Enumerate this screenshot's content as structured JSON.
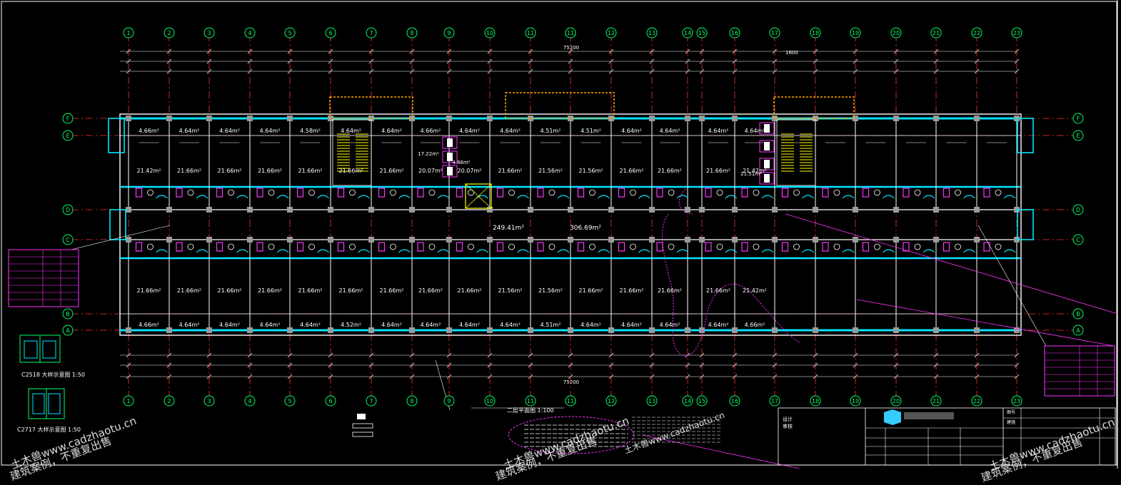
{
  "axes_top": [
    "1",
    "2",
    "3",
    "4",
    "5",
    "6",
    "7",
    "8",
    "9",
    "10",
    "11",
    "(11)",
    "12",
    "13",
    "14",
    "15",
    "16",
    "17",
    "18",
    "19",
    "20",
    "21",
    "22",
    "23"
  ],
  "axes_side": [
    "F",
    "E",
    "D",
    "C",
    "B",
    "A"
  ],
  "rooms_top": [
    "4.66m²",
    "4.64m²",
    "4.64m²",
    "4.64m²",
    "4.58m²",
    "4.64m²",
    "4.64m²",
    "4.66m²",
    "4.64m²",
    "4.64m²",
    "4.51m²",
    "4.51m²",
    "4.64m²",
    "4.64m²",
    "4.64m²",
    "4.64m²"
  ],
  "rooms_upper": [
    "21.42m²",
    "21.66m²",
    "21.66m²",
    "21.66m²",
    "21.66m²",
    "21.66m²",
    "21.66m²",
    "20.07m²",
    "20.07m²",
    "21.66m²",
    "21.56m²",
    "21.56m²",
    "21.66m²",
    "21.66m²",
    "21.66m²",
    "21.42m²"
  ],
  "rooms_lower": [
    "21.66m²",
    "21.66m²",
    "21.66m²",
    "21.66m²",
    "21.66m²",
    "21.66m²",
    "21.66m²",
    "21.66m²",
    "21.66m²",
    "21.56m²",
    "21.56m²",
    "21.66m²",
    "21.66m²",
    "21.66m²",
    "21.66m²",
    "21.42m²"
  ],
  "rooms_bottom": [
    "4.66m²",
    "4.64m²",
    "4.64m²",
    "4.64m²",
    "4.64m²",
    "4.52m²",
    "4.64m²",
    "4.64m²",
    "4.64m²",
    "4.64m²",
    "4.51m²",
    "4.64m²",
    "4.64m²",
    "4.64m²",
    "4.64m²",
    "4.66m²"
  ],
  "corridor": [
    "249.41m²",
    "306.69m²"
  ],
  "misc_area": [
    "17.22m²",
    "4.88m²",
    "21.51m²"
  ],
  "dim_overall": "75200",
  "drawing_title": "二层平面图 1:100",
  "detail_labels": [
    "C2518 大样示意图 1:50",
    "C2717 大样示意图 1:50"
  ],
  "watermark": "土木兽www.cadzhaotu.cn",
  "watermark2": "建筑案例，不重复出售",
  "title_block": {
    "col1": "图号",
    "col2": "建施"
  }
}
